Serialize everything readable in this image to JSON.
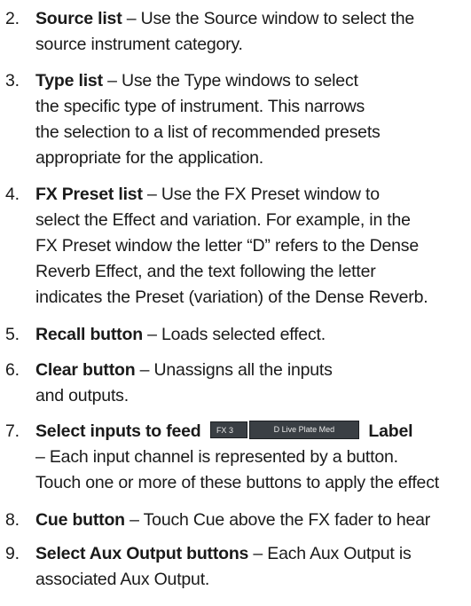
{
  "items": [
    {
      "num": "2.",
      "term": "Source list",
      "text1": " – Use the Source window to select the",
      "text2": "source instrument category."
    },
    {
      "num": "3.",
      "term": "Type list",
      "text1": " – Use the Type windows to select",
      "text2": "the specific type of instrument. This narrows",
      "text3": "the selection to a list of recommended presets",
      "text4": "appropriate for the application."
    },
    {
      "num": "4.",
      "term": "FX Preset list",
      "text1": " – Use the FX Preset window to",
      "text2": "select the Effect and variation. For example, in the",
      "text3": "FX Preset window the letter “D” refers to the Dense",
      "text4": "Reverb Effect, and the text following the letter",
      "text5": "indicates the Preset (variation) of the Dense Reverb."
    },
    {
      "num": "5.",
      "term": "Recall button",
      "text1": " – Loads selected effect."
    },
    {
      "num": "6.",
      "term": "Clear button",
      "text1": " – Unassigns all the inputs",
      "text2": "and outputs."
    },
    {
      "num": "7.",
      "term": "Select inputs to feed",
      "chip_fx": "FX 3",
      "chip_name": "D Live Plate Med",
      "term2": "Label",
      "text2": "– Each input channel is represented by a button.",
      "text3": "Touch one or more of these buttons to apply the effect"
    },
    {
      "num": "8.",
      "term": "Cue button",
      "text1": " – Touch Cue above the FX fader to hear"
    },
    {
      "num": "9.",
      "term": "Select Aux Output buttons",
      "text1": " – Each Aux Output is",
      "text2": "associated Aux Output."
    }
  ]
}
